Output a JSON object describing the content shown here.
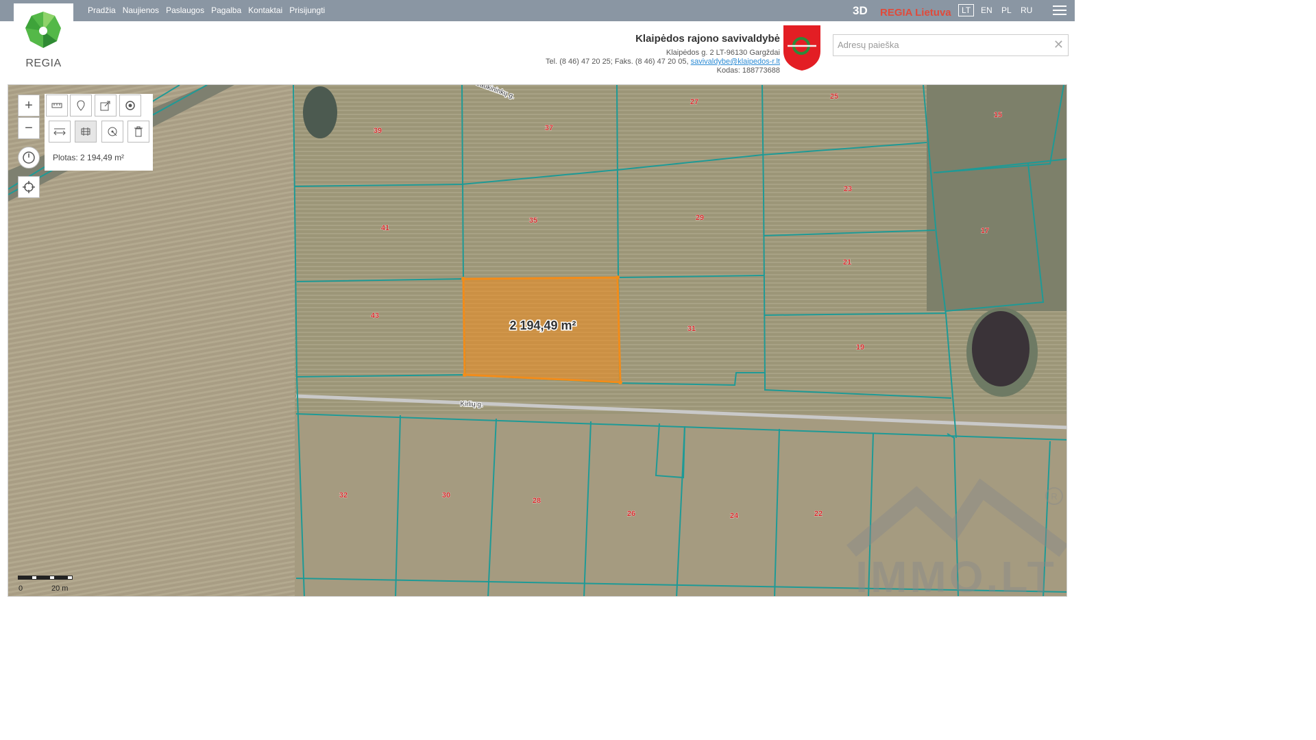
{
  "logo": {
    "text": "REGIA"
  },
  "nav": [
    "Pradžia",
    "Naujienos",
    "Paslaugos",
    "Pagalba",
    "Kontaktai",
    "Prisijungti"
  ],
  "header": {
    "btn_3d": "3D",
    "brand": "REGIA Lietuva",
    "languages": [
      "LT",
      "EN",
      "PL",
      "RU"
    ],
    "active_language": "LT"
  },
  "municipality": {
    "name": "Klaipėdos rajono savivaldybė",
    "address": "Klaipėdos g. 2 LT-96130 Gargždai",
    "phones": "Tel. (8 46) 47 20 25; Faks. (8 46) 47 20 05,",
    "email": "savivaldybe@klaipedos-r.lt",
    "code": "Kodas: 188773688"
  },
  "search": {
    "placeholder": "Adresų paieška",
    "value": ""
  },
  "measure": {
    "panel_text": "Plotas: 2 194,49 m²",
    "label": "2 194,49 m²"
  },
  "map": {
    "streets": [
      "Kirlių g.",
      "Laukininkų g."
    ],
    "parcels": [
      "39",
      "37",
      "27",
      "25",
      "15",
      "41",
      "35",
      "29",
      "23",
      "17",
      "21",
      "43",
      "31",
      "19",
      "32",
      "30",
      "28",
      "26",
      "24",
      "22"
    ]
  },
  "scale": {
    "start": "0",
    "end": "20 m"
  },
  "watermark": "IMMO.LT",
  "colors": {
    "topbar": "#8a96a3",
    "brand": "#e04a3b",
    "parcel_line": "#1e9a96",
    "highlight": "#f28c1a"
  }
}
